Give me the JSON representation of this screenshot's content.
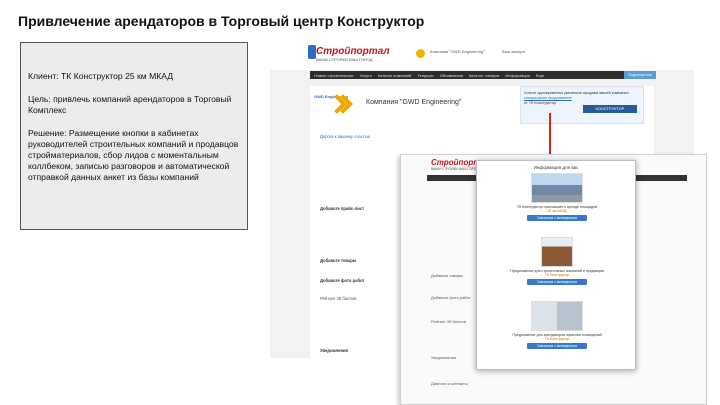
{
  "slide": {
    "title": "Привлечение арендаторов в Торговый центр Конструктор"
  },
  "info": {
    "client": "Клиент: ТК Конструктор 25 км МКАД",
    "goal": "Цель: привлечь компаний арендаторов в Торговый Комплекс",
    "solution": "Решение: Размещение кнопки в кабинетах руководителей строительных компаний и продавцов стройматериалов, сбор лидов с моментальным коллбеком, записью разговоров и автоматической отправкой данных анкет из базы компаний"
  },
  "site": {
    "logo": "Стройпортал",
    "logo_sub": "ВАШИ СТРОЙКИ ВАШ ГОРОД",
    "header_company": "Компания \"GWD Engineering\"",
    "header_user": "Ваш аккаунт",
    "nav": [
      "Новые строительные",
      "Услуги",
      "Каталог компаний",
      "Тендеры",
      "Объявления",
      "Каталог товаров",
      "Информация",
      "Еще"
    ],
    "nav_button": "Подписаться",
    "company_logo_sub": "GWD Engineering",
    "company_name": "Компания \"GWD Engineering\"",
    "ad_lines": [
      "Хотите одновременно увеличить продажи вашей компании",
      "специальное предложение",
      "от ТК Конструктор"
    ],
    "ad_button": "КОНСТРУКТОР",
    "side": {
      "about": "Дорога к вашему счастью",
      "pricelist": "Добавьте прайс-лист",
      "goods": "Добавьте товары",
      "photos": "Добавьте фото работ",
      "rating": "Рейтинг 35 баллов",
      "notices": "Уведомления",
      "chat": "Диалоги и контакты \"GWD\""
    }
  },
  "front": {
    "logo": "Стройпортал",
    "logo_sub": "ВАШИ СТРОЙКИ ВАШ ГОРОД",
    "lines": [
      "Добавьте товары",
      "Добавьте фото работ",
      "Рейтинг 35 баллов",
      "Уведомления",
      "Диалоги и контакты"
    ],
    "modal": {
      "title": "Информация для вас",
      "cards": [
        {
          "text": "ТК Конструктор приглашает к аренде площадей",
          "sub": "25 км МКАД",
          "button": "Связаться с менеджером"
        },
        {
          "text": "Предложение для строительных компаний и продавцов",
          "sub": "ТК Конструктор",
          "button": "Связаться с менеджером"
        },
        {
          "text": "Предложение для арендаторов офисных помещений",
          "sub": "ТК Конструктор",
          "button": "Связаться с менеджером"
        }
      ]
    }
  },
  "colors": {
    "accent": "#2a6ec4",
    "brand": "#c0161b",
    "pointer": "#e02020"
  }
}
